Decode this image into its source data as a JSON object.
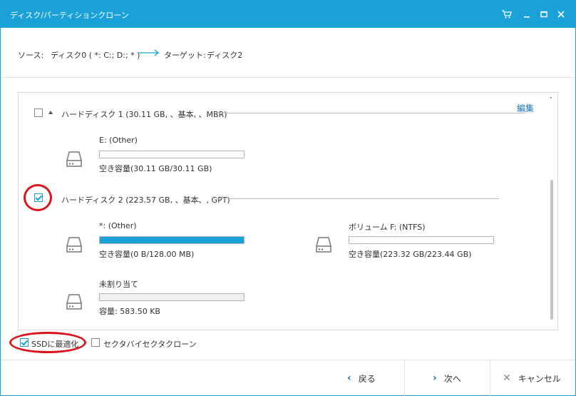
{
  "window": {
    "title": "ディスク/パーティションクローン",
    "controls": [
      "cart-icon",
      "minimize-icon",
      "maximize-icon",
      "close-icon"
    ]
  },
  "path": {
    "source_label": "ソース:",
    "source_value": "ディスク0 ( *: C:; D:; * )",
    "target_label": "ターゲット:",
    "target_value": "ディスク2"
  },
  "disks": [
    {
      "header": "ハードディスク 1 (30.11 GB, 、基本, 、MBR)",
      "checked": false,
      "partitions": [
        {
          "name": "E: (Other)",
          "capacity": "空き容量(30.11 GB/30.11 GB)",
          "used_fraction": 0
        }
      ]
    },
    {
      "header": "ハードディスク 2 (223.57 GB, 、基本、, GPT)",
      "checked": true,
      "edit_label": "編集",
      "partitions": [
        {
          "name": "*: (Other)",
          "capacity": "空き容量(0 B/128.00 MB)",
          "used_fraction": 1
        },
        {
          "name": "ボリューム F: (NTFS)",
          "capacity": "空き容量(223.32 GB/223.44 GB)",
          "used_fraction": 0
        },
        {
          "name": "未割り当て",
          "capacity": "容量: 583.50 KB",
          "used_fraction": 0
        }
      ]
    }
  ],
  "options": {
    "ssd_label": "SSDに最適化",
    "ssd_checked": true,
    "sector_label": "セクタバイセクタクローン",
    "sector_checked": false
  },
  "footer": {
    "back_label": "戻る",
    "next_label": "次へ",
    "cancel_label": "キャンセル"
  },
  "colors": {
    "accent": "#1aa1d7",
    "highlight_ring": "#d9141c",
    "link": "#1a73b8"
  }
}
